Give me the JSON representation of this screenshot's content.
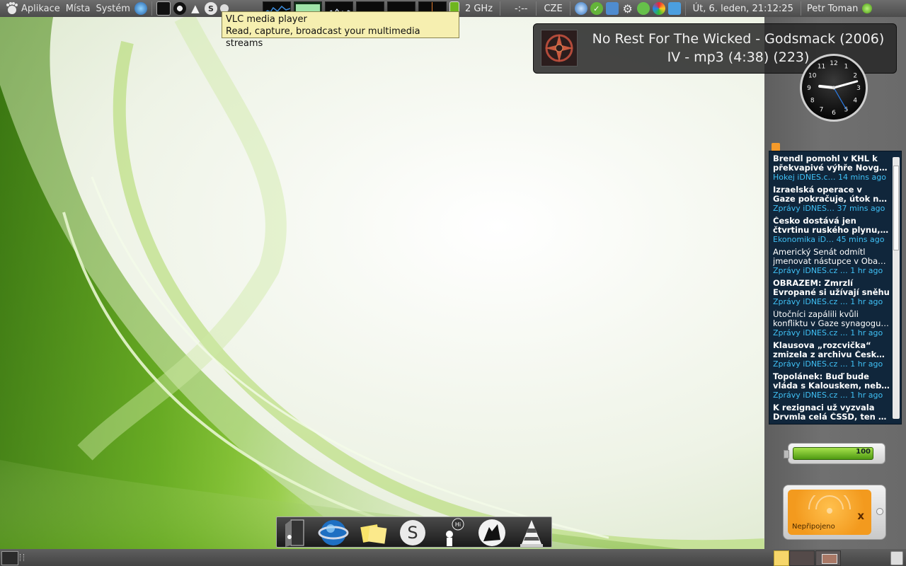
{
  "top_panel": {
    "menus": [
      {
        "label": "Aplikace"
      },
      {
        "label": "Místa"
      },
      {
        "label": "Systém"
      }
    ],
    "cpu_freq": "2 GHz",
    "timer": "-:--",
    "keyboard_layout": "CZE",
    "datetime": "Út,  6. leden, 21:12:25",
    "user": "Petr Toman"
  },
  "tooltip": {
    "title": "VLC media player",
    "subtitle": "Read, capture, broadcast your multimedia streams"
  },
  "notification": {
    "line1": "No Rest For The Wicked - Godsmack (2006)",
    "line2": "IV - mp3 (4:38) (223)"
  },
  "clock": {
    "numbers": [
      "12",
      "1",
      "2",
      "3",
      "4",
      "5",
      "6",
      "7",
      "8",
      "9",
      "10",
      "11"
    ],
    "hour": 9,
    "minute": 12,
    "second": 25
  },
  "rss": {
    "items": [
      {
        "title": "Brendl pomohl v KHL k",
        "title2": "překvapivé výhře Novgo…",
        "source": "Hokej iDNES.c… 14 mins ago",
        "bold": true
      },
      {
        "title": "Izraelská operace v",
        "title2": "Gaze pokračuje, útok n…",
        "source": "Zprávy iDNES… 37 mins ago",
        "bold": true
      },
      {
        "title": "Česko dostává jen",
        "title2": "čtvrtinu ruského plynu, …",
        "source": "Ekonomika iD… 45 mins ago",
        "bold": true
      },
      {
        "title": "Americký Senát odmítl",
        "title2": "jmenovat nástupce v Oba…",
        "source": "Zprávy iDNES.cz  … 1 hr ago",
        "bold": false
      },
      {
        "title": "OBRAZEM: Zmrzlí",
        "title2": "Evropané si užívají sněhu",
        "source": "Zprávy iDNES.cz  … 1 hr ago",
        "bold": true
      },
      {
        "title": "Útočníci zapálili kvůli",
        "title2": "konfliktu v Gaze synagogu …",
        "source": "Zprávy iDNES.cz  … 1 hr ago",
        "bold": false
      },
      {
        "title": "Klausova „rozcvička“",
        "title2": "zmizela z archivu Česk…",
        "source": "Zprávy iDNES.cz  … 1 hr ago",
        "bold": true
      },
      {
        "title": "Topolánek: Buď bude",
        "title2": "vláda s Kalouskem, neb…",
        "source": "Zprávy iDNES.cz  … 1 hr ago",
        "bold": true
      },
      {
        "title": "K rezignaci už vyzvala",
        "title2": "Drvmla celá ČSSD, ten s…",
        "source": "",
        "bold": true
      }
    ]
  },
  "battery": {
    "value": "100",
    "level_percent": 100
  },
  "status_widget": {
    "label": "Nepřipojeno",
    "close_glyph": "x"
  },
  "dock": {
    "items": [
      {
        "name": "switch-user-icon"
      },
      {
        "name": "browser-globe-icon"
      },
      {
        "name": "sticky-notes-icon"
      },
      {
        "name": "skype-icon"
      },
      {
        "name": "messenger-hi-icon"
      },
      {
        "name": "wolf-app-icon"
      },
      {
        "name": "vlc-cone-icon"
      }
    ],
    "messenger_badge": "Hi",
    "skype_letter": "S"
  },
  "colors": {
    "panel": "#555555",
    "rss_bg": "#10263b",
    "rss_source": "#3fc0f5",
    "tooltip_bg": "#f6efb0",
    "accent_green": "#6fb51f"
  }
}
